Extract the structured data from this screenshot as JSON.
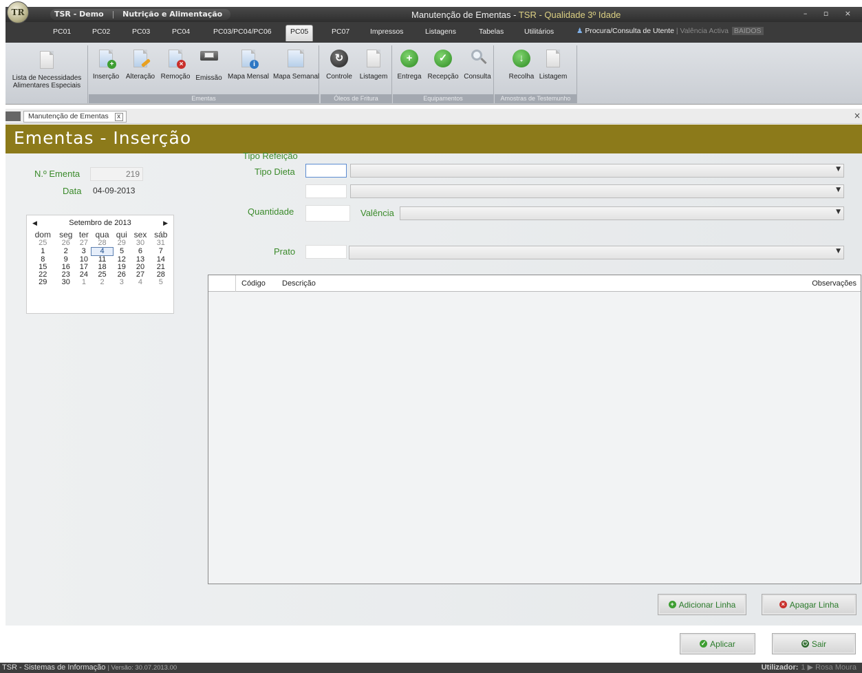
{
  "app": {
    "logo_text": "TR",
    "title_left_app": "TSR - Demo",
    "title_left_module": "Nutrição e Alimentação",
    "window_title_prefix": "Manutenção de Ementas - ",
    "window_title_product": "TSR - Qualidade 3º Idade",
    "window_controls": "– ▫ ×"
  },
  "tabs": [
    {
      "label": "PC01"
    },
    {
      "label": "PC02"
    },
    {
      "label": "PC03"
    },
    {
      "label": "PC04"
    },
    {
      "label": "PC03/PC04/PC06"
    },
    {
      "label": "PC05"
    },
    {
      "label": "PC07"
    },
    {
      "label": "Impressos"
    },
    {
      "label": "Listagens"
    },
    {
      "label": "Tabelas"
    },
    {
      "label": "Utilitários"
    }
  ],
  "search": {
    "label": "Procura/Consulta de Utente",
    "valencia_label": "| Valência Activa",
    "valencia_value": "BAIDOS"
  },
  "ribbon": {
    "lista_line1": "Lista de Necessidades",
    "lista_line2": "Alimentares Especiais",
    "ementas_buttons": [
      "Inserção",
      "Alteração",
      "Remoção",
      "Emissão",
      "Mapa Mensal",
      "Mapa Semanal"
    ],
    "ementas_caption": "Ementas",
    "oleos_buttons": [
      "Controle",
      "Listagem"
    ],
    "oleos_caption": "Óleos de Fritura",
    "equip_buttons": [
      "Entrega",
      "Recepção",
      "Consulta"
    ],
    "equip_caption": "Equipamentos",
    "amostras_buttons": [
      "Recolha",
      "Listagem"
    ],
    "amostras_caption": "Amostras de Testemunho"
  },
  "document": {
    "tab_label": "Manutenção de Ementas",
    "tab_close": "x",
    "strip_close": "×"
  },
  "page": {
    "title": "Ementas - Inserção"
  },
  "form": {
    "ementa_label": "N.º Ementa",
    "ementa_value": "219",
    "data_label": "Data",
    "data_value": "04-09-2013",
    "tipo_refeicao_label": "Tipo Refeição",
    "tipo_dieta_label": "Tipo Dieta",
    "quantidade_label": "Quantidade",
    "valencia_label": "Valência",
    "prato_label": "Prato"
  },
  "calendar": {
    "month_label": "Setembro de 2013",
    "days": [
      "dom",
      "seg",
      "ter",
      "qua",
      "qui",
      "sex",
      "sáb"
    ],
    "weeks": [
      [
        "25",
        "26",
        "27",
        "28",
        "29",
        "30",
        "31"
      ],
      [
        "1",
        "2",
        "3",
        "4",
        "5",
        "6",
        "7"
      ],
      [
        "8",
        "9",
        "10",
        "11",
        "12",
        "13",
        "14"
      ],
      [
        "15",
        "16",
        "17",
        "18",
        "19",
        "20",
        "21"
      ],
      [
        "22",
        "23",
        "24",
        "25",
        "26",
        "27",
        "28"
      ],
      [
        "29",
        "30",
        "1",
        "2",
        "3",
        "4",
        "5"
      ]
    ],
    "selected": "4"
  },
  "grid": {
    "columns": [
      "Código",
      "Descrição",
      "Observações"
    ]
  },
  "buttons": {
    "add_line": "Adicionar Linha",
    "delete_line": "Apagar Linha",
    "apply": "Aplicar",
    "exit": "Sair"
  },
  "status": {
    "company": "TSR - Sistemas de Informação",
    "version": "| Versão:  30.07.2013.00",
    "user_label": "Utilizador:",
    "user_value": "1 ▶ Rosa Moura"
  },
  "colors": {
    "header_band": "#8c7a1a",
    "label_green": "#3a8a2a",
    "title_accent": "#dcd083"
  }
}
